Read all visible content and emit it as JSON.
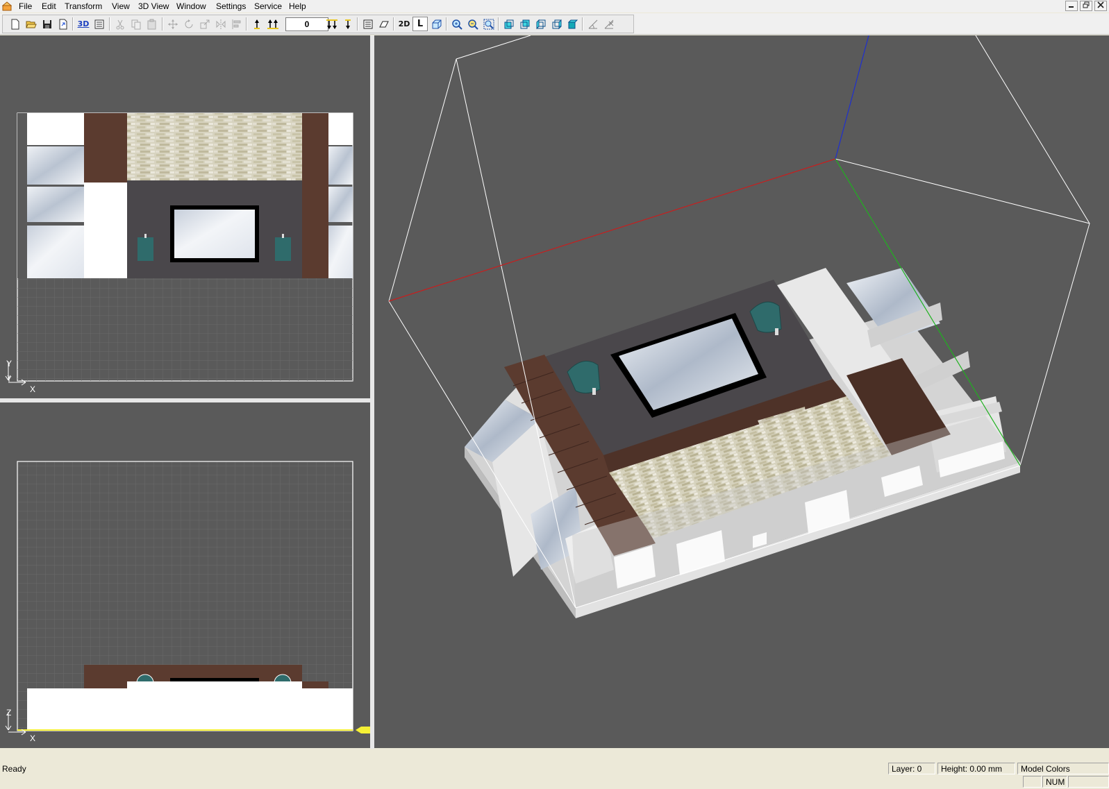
{
  "window": {
    "app_icon": "app-icon",
    "controls": [
      "minimize-icon",
      "restore-icon",
      "close-icon"
    ]
  },
  "menu": [
    "File",
    "Edit",
    "Transform",
    "View",
    "3D View",
    "Window",
    "Settings",
    "Service",
    "Help"
  ],
  "toolbar": {
    "layer_value": "0",
    "btn_3d": "3D",
    "btn_2d": "2D",
    "btn_l": "L",
    "icons": [
      "new-icon",
      "open-icon",
      "save-icon",
      "export-icon",
      "3d-view-icon",
      "properties-icon",
      "cut-icon",
      "copy-icon",
      "paste-icon",
      "move-icon",
      "rotate-icon",
      "scale-icon",
      "mirror-icon",
      "align-icon",
      "level-up-icon",
      "level-up-all-icon",
      "level-down-all-icon",
      "level-down-icon",
      "list-icon",
      "perspective-icon",
      "box-icon",
      "zoom-in-icon",
      "zoom-out-icon",
      "zoom-fit-icon",
      "view-front-icon",
      "view-back-icon",
      "view-left-icon",
      "view-right-icon",
      "view-top-icon",
      "measure-icon",
      "disable-icon"
    ]
  },
  "views": {
    "top_view": {
      "axis_up": "Y",
      "axis_right": "X"
    },
    "front_view": {
      "axis_up": "Z",
      "axis_right": "X"
    },
    "perspective_view": {
      "axis_colors": {
        "x": "#c81e1e",
        "y": "#1fb11f",
        "z": "#1e2fd0"
      }
    }
  },
  "colors": {
    "viewport_bg": "#5a5a5a",
    "wood": "#5b3b2f",
    "stone": "#d9d4c0",
    "panel": "#4a474b",
    "grid_line": "#6b6b6b"
  },
  "status": {
    "text": "Ready",
    "layer": "Layer: 0",
    "height": "Height: 0.00 mm",
    "colors": "Model Colors",
    "num": "NUM"
  }
}
